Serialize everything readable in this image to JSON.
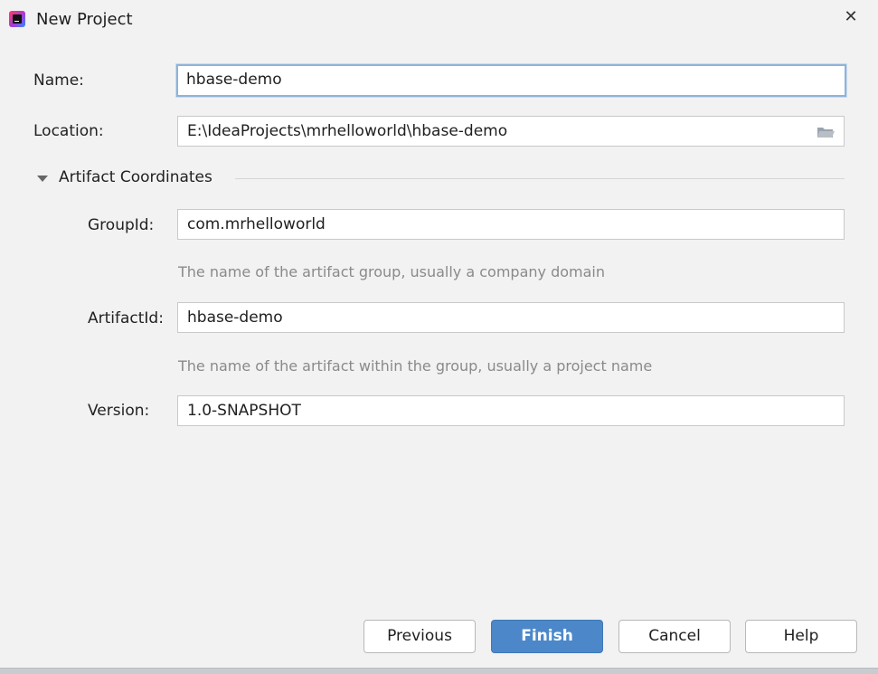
{
  "window": {
    "title": "New Project",
    "close_symbol": "✕",
    "app_icon": "intellij-idea-icon"
  },
  "form": {
    "name": {
      "label": "Name:",
      "value": "hbase-demo"
    },
    "location": {
      "label": "Location:",
      "value": "E:\\IdeaProjects\\mrhelloworld\\hbase-demo",
      "icon": "folder-icon"
    }
  },
  "artifact": {
    "section_title": "Artifact Coordinates",
    "expanded": true,
    "group_id": {
      "label": "GroupId:",
      "value": "com.mrhelloworld",
      "hint": "The name of the artifact group, usually a company domain"
    },
    "artifact_id": {
      "label": "ArtifactId:",
      "value": "hbase-demo",
      "hint": "The name of the artifact within the group, usually a project name"
    },
    "version": {
      "label": "Version:",
      "value": "1.0-SNAPSHOT"
    }
  },
  "buttons": {
    "previous": "Previous",
    "finish": "Finish",
    "cancel": "Cancel",
    "help": "Help"
  },
  "colors": {
    "primary": "#4c88c9",
    "focus_ring": "#8fb3d9",
    "background": "#f2f2f2"
  }
}
